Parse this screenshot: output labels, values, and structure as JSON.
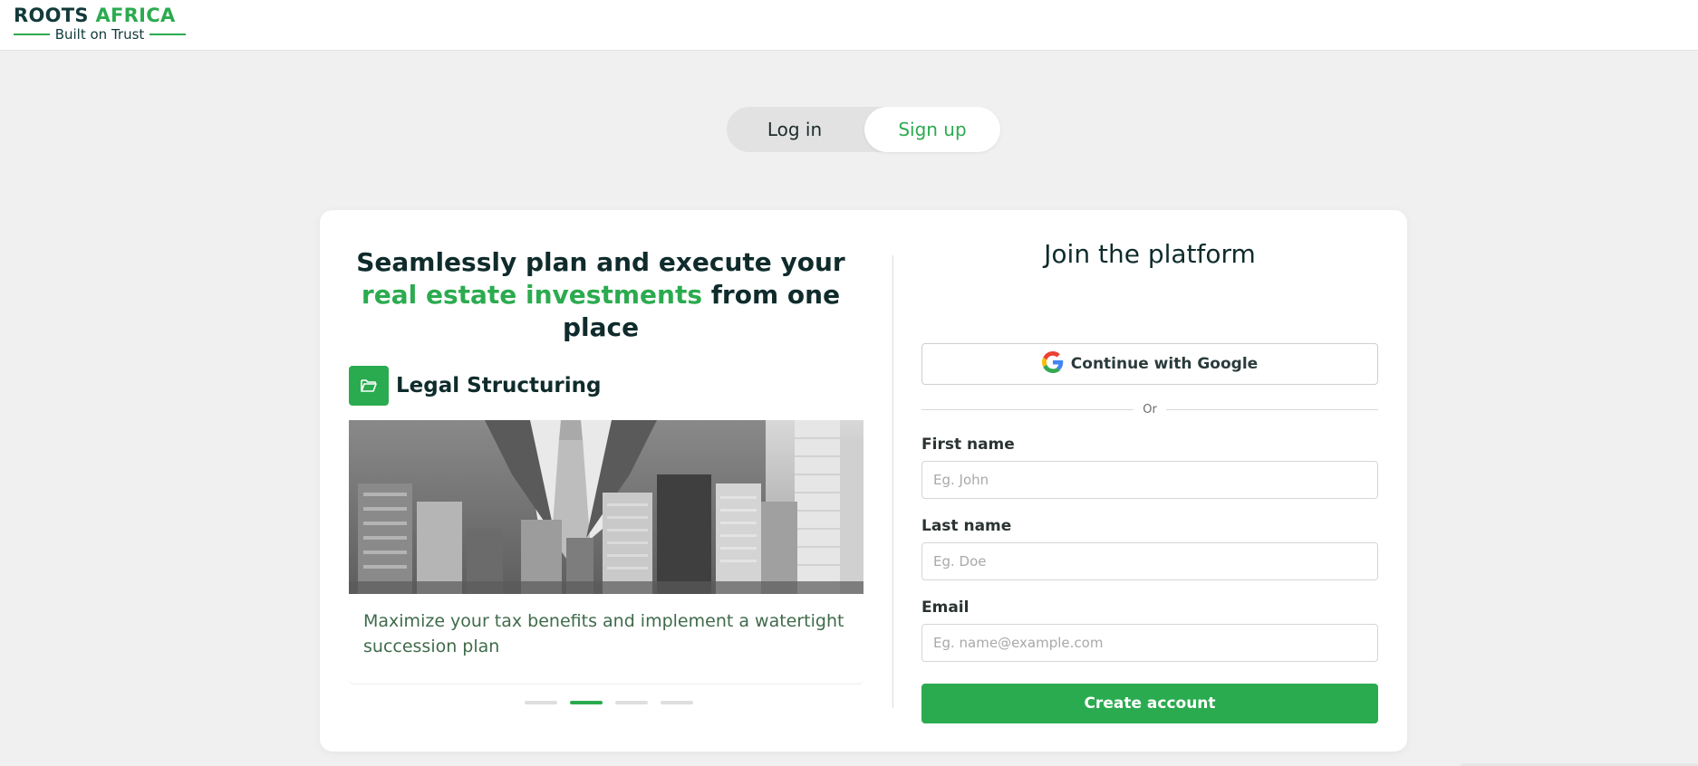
{
  "brand": {
    "name_part1": "ROOTS",
    "name_part2": "AFRICA",
    "tagline": "Built on Trust",
    "accent_color": "#2bab4f"
  },
  "auth_toggle": {
    "login_label": "Log in",
    "signup_label": "Sign up",
    "selected": "Sign up"
  },
  "promo": {
    "headline_part1": "Seamlessly plan and execute your",
    "headline_highlight": "real estate investments",
    "headline_part2": "from one place",
    "slide": {
      "icon": "folder-open-icon",
      "title": "Legal Structuring",
      "description": "Maximize your tax benefits and implement a watertight succession plan"
    },
    "carousel": {
      "total": 4,
      "active_index": 1
    }
  },
  "form": {
    "title": "Join the platform",
    "google_label": "Continue with Google",
    "separator": "Or",
    "first_name": {
      "label": "First name",
      "placeholder": "Eg. John",
      "value": ""
    },
    "last_name": {
      "label": "Last name",
      "placeholder": "Eg. Doe",
      "value": ""
    },
    "email": {
      "label": "Email",
      "placeholder": "Eg. name@example.com",
      "value": ""
    },
    "submit_label": "Create account"
  }
}
